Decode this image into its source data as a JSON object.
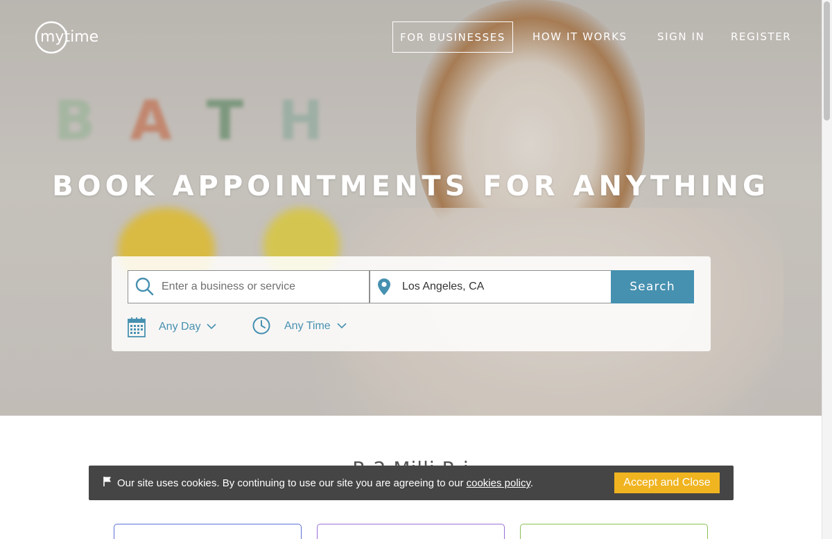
{
  "brand": {
    "logo_text": "mytime"
  },
  "nav": {
    "for_businesses": "FOR BUSINESSES",
    "how_it_works": "HOW IT WORKS",
    "sign_in": "SIGN IN",
    "register": "REGISTER"
  },
  "hero": {
    "headline": "BOOK APPOINTMENTS FOR ANYTHING",
    "background_letters": [
      "B",
      "A",
      "T",
      "H"
    ]
  },
  "search": {
    "business_placeholder": "Enter a business or service",
    "location_value": "Los Angeles, CA",
    "button_label": "Search",
    "day_filter": "Any Day",
    "time_filter": "Any Time",
    "icons": [
      "search-icon",
      "location-pin-icon",
      "calendar-icon",
      "clock-icon",
      "chevron-down-icon"
    ]
  },
  "section": {
    "title_partial": "R        2 Milli   R   i"
  },
  "cookie": {
    "message": "Our site uses cookies. By continuing to use our site you are agreeing to our ",
    "link_text": "cookies policy",
    "message_end": ".",
    "accept_label": "Accept and Close"
  },
  "colors": {
    "accent": "#4690b0",
    "cookie_bar": "#454545",
    "accept_button": "#f0b420",
    "card_borders": [
      "#5b6fd6",
      "#9a6fd6",
      "#8bbf56"
    ]
  }
}
